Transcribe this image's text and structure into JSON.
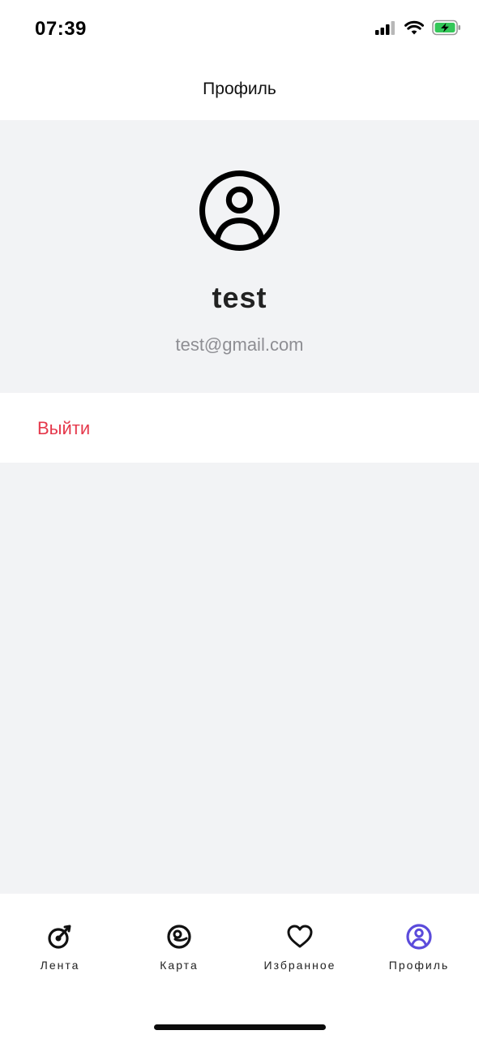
{
  "status_bar": {
    "time": "07:39",
    "icons": [
      "cellular-signal-icon",
      "wifi-icon",
      "battery-charging-icon"
    ]
  },
  "header": {
    "title": "Профиль"
  },
  "profile": {
    "avatar_icon": "user-circle-icon",
    "name": "test",
    "email": "test@gmail.com"
  },
  "actions": {
    "logout_label": "Выйти",
    "logout_color": "#e5394c"
  },
  "tab_bar": {
    "active_index": 3,
    "active_color": "#5b4bdb",
    "tabs": [
      {
        "label": "Лента",
        "icon": "feed-icon"
      },
      {
        "label": "Карта",
        "icon": "map-pin-icon"
      },
      {
        "label": "Избранное",
        "icon": "heart-icon"
      },
      {
        "label": "Профиль",
        "icon": "profile-icon"
      }
    ]
  },
  "colors": {
    "background": "#f2f3f5",
    "surface": "#ffffff",
    "text_secondary": "#8e8e93"
  }
}
